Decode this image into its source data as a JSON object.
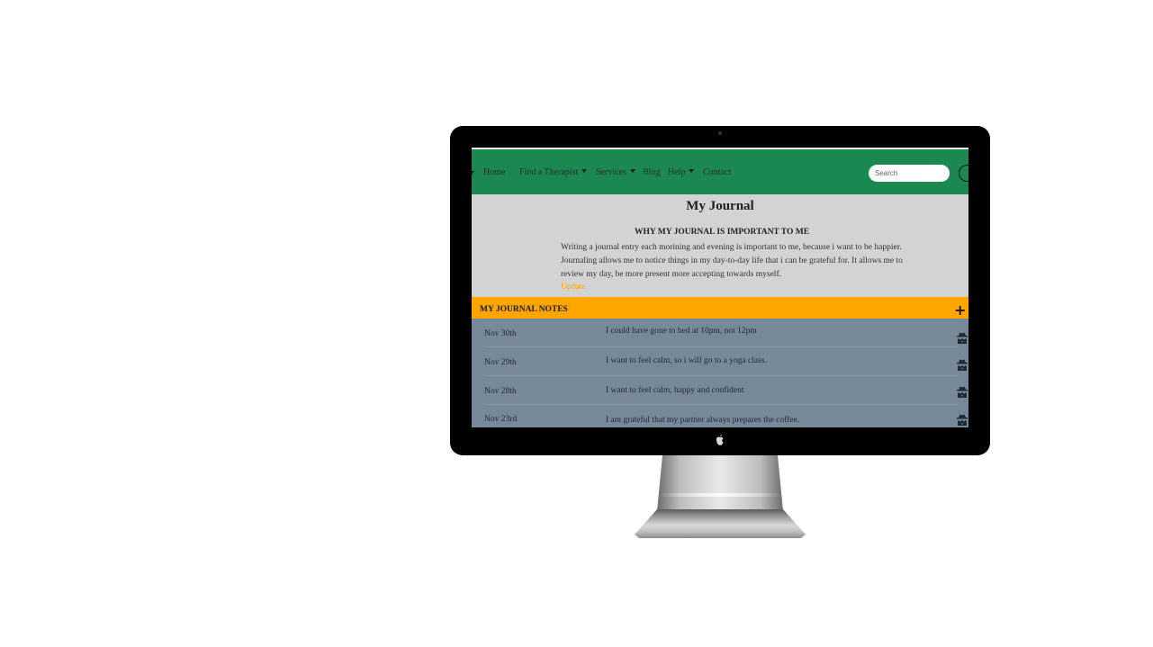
{
  "navbar": {
    "items": [
      {
        "label": "Home",
        "dropdown": false
      },
      {
        "label": "Find a Therapist",
        "dropdown": true
      },
      {
        "label": "Services",
        "dropdown": true
      },
      {
        "label": "Blog",
        "dropdown": false
      },
      {
        "label": "Help",
        "dropdown": true
      },
      {
        "label": "Contact",
        "dropdown": false
      }
    ],
    "search_placeholder": "Search"
  },
  "page": {
    "title": "My Journal",
    "why_heading": "WHY MY JOURNAL IS IMPORTANT TO ME",
    "why_text": "Writing a journal entry each morining and evening is important to me, because i want to be happier. Journaling allows me to notice things in my day-to-day life that i can be grateful for. It allows me to review my day, be more present more accepting towards myself.",
    "update_label": "Update"
  },
  "notes": {
    "title": "MY JOURNAL NOTES",
    "add_symbol": "+",
    "items": [
      {
        "date": "Nov 30th",
        "text": "I could have gone to bed at 10pm, not 12pm"
      },
      {
        "date": "Nov 29th",
        "text": "I want to feel calm, so i will go to a yoga class."
      },
      {
        "date": "Nov 28th",
        "text": "I want to feel calm, happy and confident"
      },
      {
        "date": "Nov 23rd",
        "text": "I am grateful that my partner always prepares the coffee."
      }
    ],
    "row_icon": "spy-icon"
  },
  "colors": {
    "navbar": "#1b8751",
    "notes_header": "#ffa500",
    "notes_list": "#778899",
    "page_bg": "#d3d3d3",
    "update_link": "#ffa500"
  }
}
